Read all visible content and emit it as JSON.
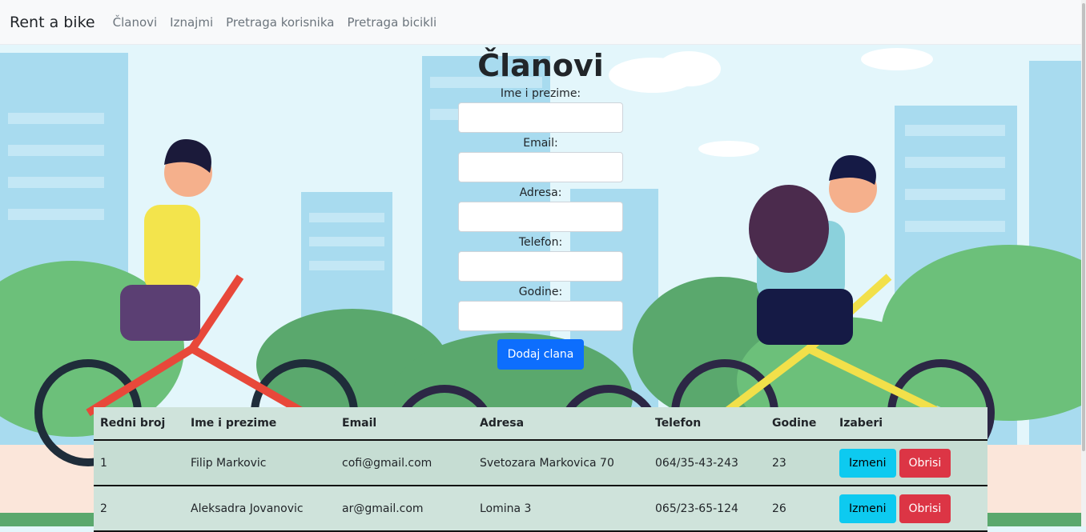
{
  "navbar": {
    "brand": "Rent a bike",
    "links": [
      "Članovi",
      "Iznajmi",
      "Pretraga korisnika",
      "Pretraga bicikli"
    ]
  },
  "form": {
    "title": "Članovi",
    "fields": [
      {
        "label": "Ime i prezime:",
        "value": ""
      },
      {
        "label": "Email:",
        "value": ""
      },
      {
        "label": "Adresa:",
        "value": ""
      },
      {
        "label": "Telefon:",
        "value": ""
      },
      {
        "label": "Godine:",
        "value": ""
      }
    ],
    "submit_label": "Dodaj clana"
  },
  "table": {
    "headers": [
      "Redni broj",
      "Ime i prezime",
      "Email",
      "Adresa",
      "Telefon",
      "Godine",
      "Izaberi"
    ],
    "rows": [
      [
        "1",
        "Filip Markovic",
        "cofi@gmail.com",
        "Svetozara Markovica 70",
        "064/35-43-243",
        "23"
      ],
      [
        "2",
        "Aleksadra Jovanovic",
        "ar@gmail.com",
        "Lomina 3",
        "065/23-65-124",
        "26"
      ]
    ],
    "edit_label": "Izmeni",
    "delete_label": "Obrisi"
  },
  "colors": {
    "primary": "#0d6efd",
    "info": "#0dcaf0",
    "danger": "#dc3545",
    "table_bg": "#cfe3db"
  }
}
